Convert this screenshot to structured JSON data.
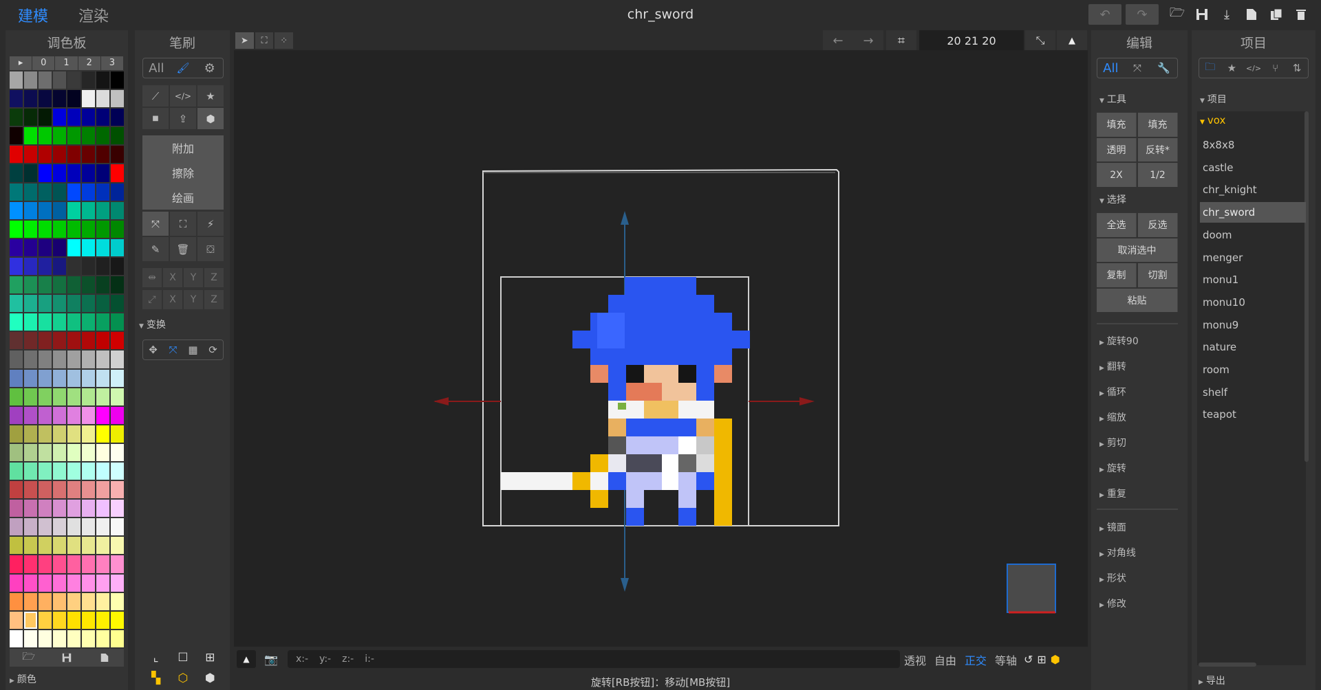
{
  "top": {
    "tab_model": "建模",
    "tab_render": "渲染",
    "title": "chr_sword"
  },
  "palette": {
    "title": "调色板",
    "header": [
      "▸",
      "0",
      "1",
      "2",
      "3"
    ],
    "footer_label": "颜色",
    "colors": [
      "#a6a6a6",
      "#8a8a8a",
      "#6e6e6e",
      "#525252",
      "#3a3a3a",
      "#262626",
      "#141414",
      "#000000",
      "#101060",
      "#0c0c50",
      "#080840",
      "#050530",
      "#020220",
      "#f0f0f0",
      "#dcdcdc",
      "#c0c0c0",
      "#0b3b0b",
      "#072a07",
      "#041a04",
      "#0000dd",
      "#0000bb",
      "#000099",
      "#000077",
      "#000055",
      "#100000",
      "#00e000",
      "#00c800",
      "#00b000",
      "#009800",
      "#008000",
      "#006800",
      "#005000",
      "#e00000",
      "#c80000",
      "#b00000",
      "#980000",
      "#800000",
      "#680000",
      "#500000",
      "#380000",
      "#004040",
      "#003030",
      "#0000ff",
      "#0000dd",
      "#0000bb",
      "#000099",
      "#000077",
      "#ff0000",
      "#007878",
      "#006c6c",
      "#006060",
      "#005454",
      "#0048ff",
      "#003cdd",
      "#0030bb",
      "#002499",
      "#0090ff",
      "#0080e0",
      "#0070c0",
      "#0060a0",
      "#00d0a0",
      "#00b890",
      "#00a080",
      "#008870",
      "#00ff00",
      "#00ee00",
      "#00dd00",
      "#00cc00",
      "#00bb00",
      "#00aa00",
      "#009900",
      "#008800",
      "#2a00a0",
      "#240090",
      "#1e0080",
      "#180070",
      "#00ffff",
      "#00eeee",
      "#00dddd",
      "#00cccc",
      "#3030e0",
      "#2828c0",
      "#2020a0",
      "#181880",
      "#303030",
      "#282828",
      "#202020",
      "#181818",
      "#20a060",
      "#1c9055",
      "#18804a",
      "#147040",
      "#106035",
      "#0c502a",
      "#084020",
      "#043015",
      "#20c0a0",
      "#1cb090",
      "#18a080",
      "#149070",
      "#108060",
      "#0c7050",
      "#086040",
      "#045030",
      "#20ffc0",
      "#1cf0b0",
      "#18e0a0",
      "#14d090",
      "#10c080",
      "#0cb070",
      "#08a060",
      "#049050",
      "#603030",
      "#702828",
      "#802020",
      "#901818",
      "#a01010",
      "#b00808",
      "#c00000",
      "#d00000",
      "#606060",
      "#707070",
      "#808080",
      "#909090",
      "#a0a0a0",
      "#b0b0b0",
      "#c0c0c0",
      "#d0d0d0",
      "#6080c0",
      "#7090c8",
      "#80a0d0",
      "#90b0d8",
      "#a0c0e0",
      "#b0d0e8",
      "#c0e0f0",
      "#d0f0f8",
      "#60c040",
      "#70c850",
      "#80d060",
      "#90d870",
      "#a0e080",
      "#b0e890",
      "#c0f0a0",
      "#d0f8b0",
      "#a040c0",
      "#b050c8",
      "#c060d0",
      "#d070d8",
      "#e080e0",
      "#f090e8",
      "#ff00ff",
      "#ee00ee",
      "#a0a040",
      "#b0b050",
      "#c0c060",
      "#d0d070",
      "#e0e080",
      "#f0f090",
      "#ffff00",
      "#eeee00",
      "#a0c080",
      "#b0d090",
      "#c0e0a0",
      "#d0f0b0",
      "#e0ffc0",
      "#f0ffd0",
      "#ffffe0",
      "#fffff0",
      "#60e0a0",
      "#70e8b0",
      "#80f0c0",
      "#90f8d0",
      "#a0ffe0",
      "#b0fff0",
      "#c0ffff",
      "#d0ffff",
      "#c04040",
      "#c85050",
      "#d06060",
      "#d87070",
      "#e08080",
      "#e89090",
      "#f0a0a0",
      "#f8b0b0",
      "#c060a0",
      "#c870b0",
      "#d080c0",
      "#d890d0",
      "#e0a0e0",
      "#e8b0f0",
      "#f0c0ff",
      "#f8d0ff",
      "#c0a0c0",
      "#c8b0c8",
      "#d0c0d0",
      "#d8d0d8",
      "#e0e0e0",
      "#e8e8e8",
      "#f0f0f0",
      "#f8f8f8",
      "#c0c040",
      "#c8c850",
      "#d0d060",
      "#d8d870",
      "#e0e080",
      "#e8e890",
      "#f0f0a0",
      "#f8f8b0",
      "#ff2060",
      "#ff3070",
      "#ff4080",
      "#ff5090",
      "#ff60a0",
      "#ff70b0",
      "#ff80c0",
      "#ff90d0",
      "#ff40c0",
      "#ff50c8",
      "#ff60d0",
      "#ff70d8",
      "#ff80e0",
      "#ff90e8",
      "#ffa0f0",
      "#ffb0f8",
      "#ff9040",
      "#ffa050",
      "#ffb060",
      "#ffc070",
      "#ffd080",
      "#ffe090",
      "#fff0a0",
      "#ffffb0",
      "#ffc080",
      "#ffc860",
      "#ffd040",
      "#ffd820",
      "#ffe000",
      "#ffe800",
      "#fff000",
      "#fff800",
      "#ffffff",
      "#fffff0",
      "#ffffe0",
      "#ffffd0",
      "#ffffc0",
      "#ffffb0",
      "#ffffa0",
      "#ffff90"
    ]
  },
  "brush": {
    "title": "笔刷",
    "all": "All",
    "modes": [
      "附加",
      "擦除",
      "绘画"
    ],
    "axis": [
      "X",
      "Y",
      "Z"
    ],
    "transform_label": "变换"
  },
  "viewport": {
    "counter": "20 21 20",
    "coords": {
      "x": "x:-",
      "y": "y:-",
      "z": "z:-",
      "i": "i:-"
    },
    "views": [
      "透视",
      "自由",
      "正交",
      "等轴"
    ],
    "status": "旋转[RB按钮]：移动[MB按钮]"
  },
  "edit": {
    "title": "编辑",
    "all": "All",
    "tools_label": "工具",
    "tool_buttons": [
      [
        "填充",
        "填充"
      ],
      [
        "透明",
        "反转*"
      ],
      [
        "2X",
        "1/2"
      ]
    ],
    "select_label": "选择",
    "select_buttons": {
      "all": "全选",
      "invert": "反选",
      "deselect": "取消选中",
      "copy": "复制",
      "cut": "切割",
      "paste": "粘贴"
    },
    "folds1": [
      "旋转90",
      "翻转",
      "循环",
      "缩放",
      "剪切",
      "旋转",
      "重复"
    ],
    "folds2": [
      "镜面",
      "对角线",
      "形状",
      "修改"
    ]
  },
  "project": {
    "title": "项目",
    "section": "项目",
    "folder": "vox",
    "items": [
      "8x8x8",
      "castle",
      "chr_knight",
      "chr_sword",
      "doom",
      "menger",
      "monu1",
      "monu10",
      "monu9",
      "nature",
      "room",
      "shelf",
      "teapot"
    ],
    "selected": "chr_sword",
    "export_label": "导出"
  },
  "colors": {
    "accent": "#2f8cff",
    "folder": "#ffc400"
  }
}
